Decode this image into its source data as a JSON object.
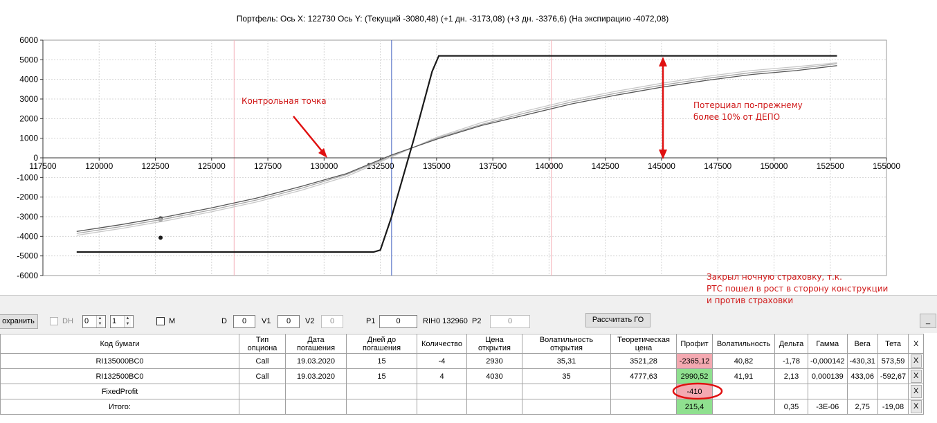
{
  "header": {
    "text": "Портфель: Ось X:  122730 Ось Y:   (Текущий -3080,48)  (+1 дн. -3173,08)  (+3 дн. -3376,6)  (На экспирацию -4072,08)"
  },
  "chart_data": {
    "type": "line",
    "xlim": [
      117500,
      155000
    ],
    "ylim": [
      -6000,
      6000
    ],
    "x_ticks": [
      "117500",
      "120000",
      "122500",
      "125000",
      "127500",
      "130000",
      "132500",
      "135000",
      "137500",
      "140000",
      "142500",
      "145000",
      "147500",
      "150000",
      "152500",
      "155000"
    ],
    "y_ticks": [
      "6000",
      "5000",
      "4000",
      "3000",
      "2000",
      "1000",
      "0",
      "-1000",
      "-2000",
      "-3000",
      "-4000",
      "-5000",
      "-6000"
    ],
    "grid": true,
    "series": [
      {
        "role": "expiration",
        "color": "#1a1a1a",
        "x": [
          119000,
          132200,
          132500,
          133000,
          134000,
          134800,
          135100,
          152800
        ],
        "y": [
          -4800,
          -4800,
          -4700,
          -3000,
          1000,
          4400,
          5200,
          5200
        ]
      },
      {
        "role": "current",
        "color": "#555555",
        "x": [
          119000,
          121000,
          123000,
          125000,
          127000,
          129000,
          131000,
          133000,
          135000,
          137000,
          139000,
          141000,
          143000,
          145000,
          147000,
          149000,
          151000,
          152800
        ],
        "y": [
          -3750,
          -3400,
          -3000,
          -2550,
          -2050,
          -1450,
          -800,
          150,
          950,
          1650,
          2200,
          2750,
          3200,
          3600,
          3950,
          4250,
          4450,
          4700
        ]
      },
      {
        "role": "plus1",
        "color": "#a8a8a8",
        "x": [
          119000,
          121000,
          123000,
          125000,
          127000,
          129000,
          131000,
          133000,
          135000,
          137000,
          139000,
          141000,
          143000,
          145000,
          147000,
          149000,
          151000,
          152800
        ],
        "y": [
          -3850,
          -3500,
          -3100,
          -2650,
          -2150,
          -1550,
          -850,
          100,
          1000,
          1700,
          2300,
          2850,
          3300,
          3700,
          4050,
          4350,
          4550,
          4800
        ]
      },
      {
        "role": "plus3",
        "color": "#c8c8c8",
        "x": [
          119000,
          121000,
          123000,
          125000,
          127000,
          129000,
          131000,
          133000,
          135000,
          137000,
          139000,
          141000,
          143000,
          145000,
          147000,
          149000,
          151000,
          152800
        ],
        "y": [
          -3950,
          -3600,
          -3200,
          -2750,
          -2250,
          -1650,
          -950,
          50,
          1050,
          1800,
          2400,
          2950,
          3400,
          3800,
          4150,
          4450,
          4650,
          4850
        ]
      }
    ],
    "vlines": [
      {
        "x": 126000,
        "color": "#f4b0b8"
      },
      {
        "x": 133000,
        "color": "#4060c0"
      },
      {
        "x": 140100,
        "color": "#f4b0b8"
      }
    ],
    "points": [
      {
        "x": 122730,
        "y": -3080,
        "color": "#555555"
      },
      {
        "x": 122730,
        "y": -3173,
        "color": "#a8a8a8"
      },
      {
        "x": 122730,
        "y": -4072,
        "color": "#1a1a1a"
      }
    ],
    "annotations": [
      {
        "text": "Контрольная точка",
        "color": "#d01818"
      },
      {
        "text": "Потерциал по-прежнему\nболее 10% от ДЕПО",
        "color": "#d01818"
      },
      {
        "text": "Закрыл ночную страховку, т.к.\nРТС пошел в рост в сторону конструкции\nи против страховки",
        "color": "#d01818"
      }
    ]
  },
  "toolbar": {
    "save_label": "охранить",
    "dh_label": "DH",
    "spin1_value": "0",
    "spin2_value": "1",
    "m_label": "M",
    "d_label": "D",
    "d_value": "0",
    "v1_label": "V1",
    "v1_value": "0",
    "v2_label": "V2",
    "v2_value": "0",
    "p1_label": "P1",
    "p1_value": "0",
    "rih_label": "RIH0 132960",
    "p2_label": "P2",
    "p2_value": "0",
    "calc_go_label": "Рассчитать ГО",
    "minimize_label": "_"
  },
  "table": {
    "headers": [
      "Код бумаги",
      "Тип опциона",
      "Дата погашения",
      "Дней до погашения",
      "Количество",
      "Цена открытия",
      "Волатильность открытия",
      "Теоретическая цена",
      "Профит",
      "Волатильность",
      "Дельта",
      "Гамма",
      "Вега",
      "Тета",
      "X"
    ],
    "rows": [
      [
        "RI135000BC0",
        "Call",
        "19.03.2020",
        "15",
        "-4",
        "2930",
        "35,31",
        "3521,28",
        "-2365,12",
        "40,82",
        "-1,78",
        "-0,000142",
        "-430,31",
        "573,59",
        "X"
      ],
      [
        "RI132500BC0",
        "Call",
        "19.03.2020",
        "15",
        "4",
        "4030",
        "35",
        "4777,63",
        "2990,52",
        "41,91",
        "2,13",
        "0,000139",
        "433,06",
        "-592,67",
        "X"
      ],
      [
        "FixedProfit",
        "",
        "",
        "",
        "",
        "",
        "",
        "",
        "-410",
        "",
        "",
        "",
        "",
        "",
        "X"
      ],
      [
        "Итого:",
        "",
        "",
        "",
        "",
        "",
        "",
        "",
        "215,4",
        "",
        "0,35",
        "-3E-06",
        "2,75",
        "-19,08",
        "X"
      ]
    ],
    "profit_colors": [
      "red",
      "green",
      "red",
      "green"
    ]
  }
}
